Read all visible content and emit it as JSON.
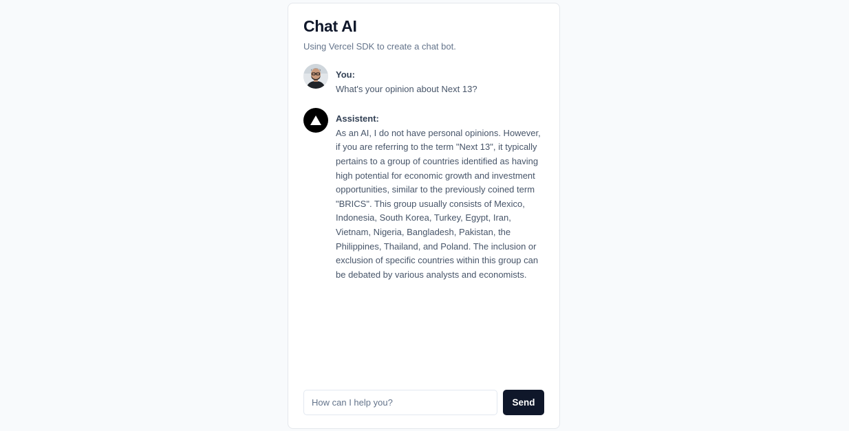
{
  "header": {
    "title": "Chat AI",
    "subtitle": "Using Vercel SDK to create a chat bot."
  },
  "messages": [
    {
      "sender": "You:",
      "avatar_icon": "user-photo-avatar",
      "text": "What's your opinion about Next 13?"
    },
    {
      "sender": "Assistent:",
      "avatar_icon": "vercel-triangle-logo",
      "text": "As an AI, I do not have personal opinions. However, if you are referring to the term \"Next 13\", it typically pertains to a group of countries identified as having high potential for economic growth and investment opportunities, similar to the previously coined term \"BRICS\". This group usually consists of Mexico, Indonesia, South Korea, Turkey, Egypt, Iran, Vietnam, Nigeria, Bangladesh, Pakistan, the Philippines, Thailand, and Poland. The inclusion or exclusion of specific countries within this group can be debated by various analysts and economists."
    }
  ],
  "composer": {
    "value": "",
    "placeholder": "How can I help you?",
    "send_label": "Send"
  },
  "colors": {
    "page_bg": "#f8fafc",
    "card_bg": "#ffffff",
    "primary": "#0f172a",
    "muted_text": "#64748b"
  }
}
